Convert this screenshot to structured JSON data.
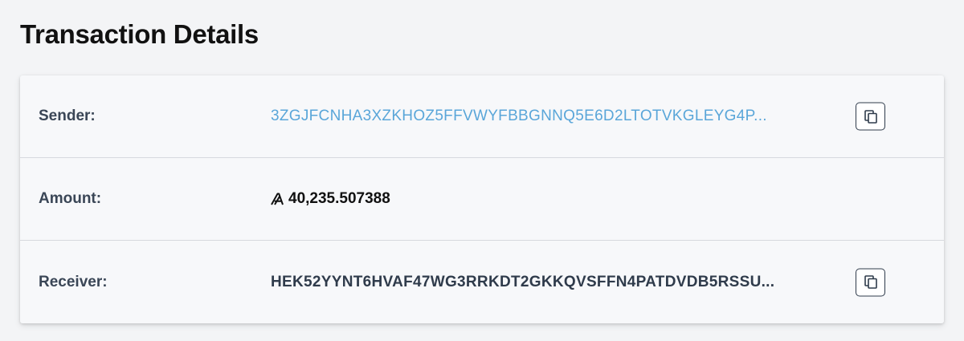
{
  "page": {
    "title": "Transaction Details"
  },
  "details": {
    "sender": {
      "label": "Sender:",
      "value": "3ZGJFCNHA3XZKHOZ5FFVWYFBBGNNQ5E6D2LTOTVKGLEYG4P..."
    },
    "amount": {
      "label": "Amount:",
      "value": "40,235.507388",
      "icon": "algo-icon"
    },
    "receiver": {
      "label": "Receiver:",
      "value": "HEK52YYNT6HVAF47WG3RRKDT2GKKQVSFFN4PATDVDB5RSSU..."
    }
  },
  "colors": {
    "background": "#f3f4f6",
    "card": "#f7f8fa",
    "link": "#5aa6d9",
    "text_dark": "#2f3b4b"
  }
}
